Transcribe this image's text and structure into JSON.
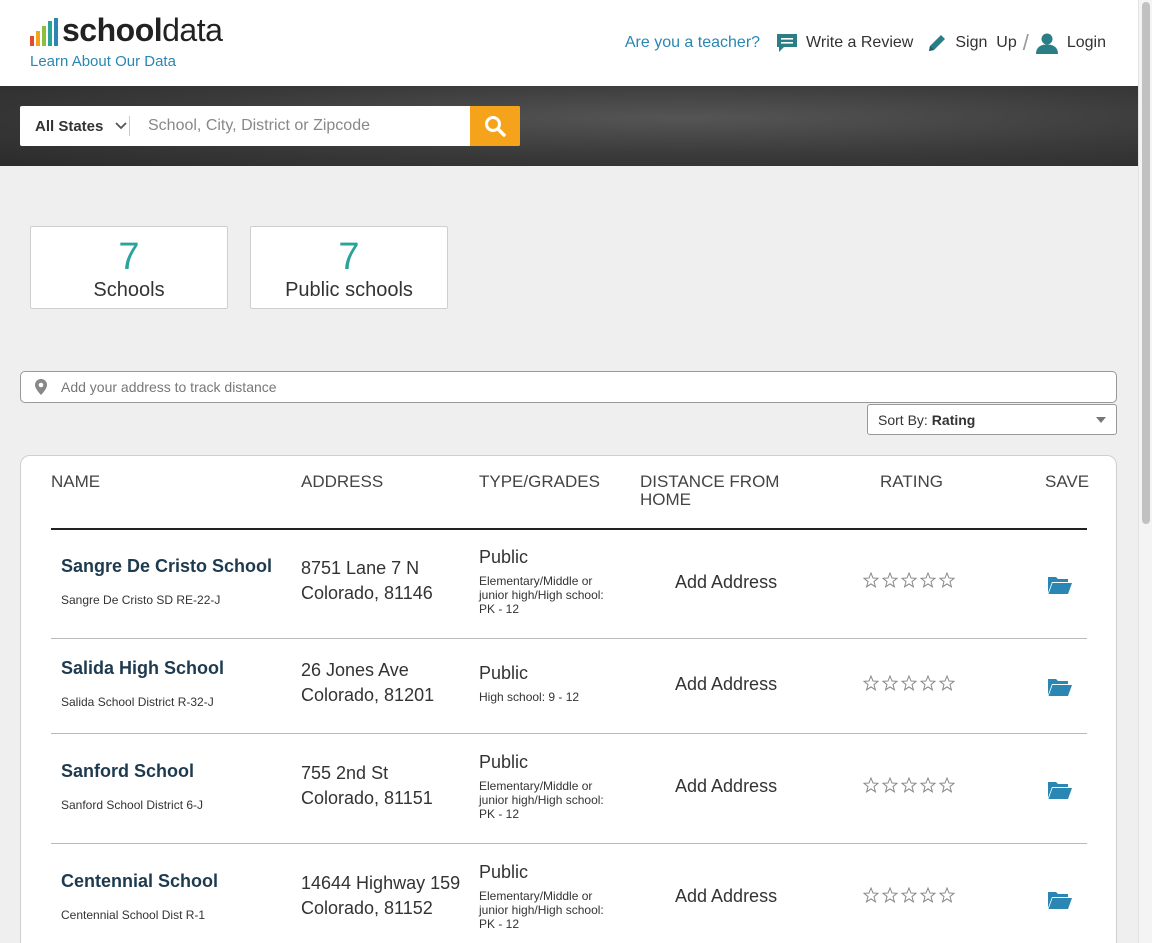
{
  "header": {
    "logo_text_bold": "school",
    "logo_text_light": "data",
    "logo_colors": [
      "#e24a33",
      "#f5a31b",
      "#8cbf3f",
      "#2aa39b",
      "#2a86b3"
    ],
    "learn_link": "Learn About Our Data",
    "teacher_link": "Are you a teacher?",
    "write_review": "Write a Review",
    "sign_up": "Sign  Up",
    "separator": "/",
    "login": "Login"
  },
  "search": {
    "state_selected": "All States",
    "placeholder": "School, City, District or Zipcode",
    "button_color": "#f5a31b"
  },
  "stats": [
    {
      "value": "7",
      "label": "Schools"
    },
    {
      "value": "7",
      "label": "Public schools"
    }
  ],
  "address_bar": {
    "placeholder": "Add your address to track distance"
  },
  "sort": {
    "label": "Sort By:",
    "value": "Rating"
  },
  "table": {
    "headers": {
      "name": "NAME",
      "address": "ADDRESS",
      "type": "TYPE/GRADES",
      "distance_line1": "DISTANCE FROM",
      "distance_line2": "HOME",
      "rating": "RATING",
      "save": "SAVE"
    },
    "rows": [
      {
        "name": "Sangre De Cristo School",
        "district": "Sangre De Cristo SD RE-22-J",
        "street": "8751 Lane 7 N",
        "city": "Colorado, 81146",
        "type": "Public",
        "grades": "Elementary/Middle or junior high/High school: PK - 12",
        "distance": "Add Address",
        "rating": 0
      },
      {
        "name": "Salida High School",
        "district": "Salida School District R-32-J",
        "street": "26 Jones Ave",
        "city": "Colorado, 81201",
        "type": "Public",
        "grades": "High school: 9 - 12",
        "distance": "Add Address",
        "rating": 0
      },
      {
        "name": "Sanford School",
        "district": "Sanford School District 6-J",
        "street": "755 2nd St",
        "city": "Colorado, 81151",
        "type": "Public",
        "grades": "Elementary/Middle or junior high/High school: PK - 12",
        "distance": "Add Address",
        "rating": 0
      },
      {
        "name": "Centennial School",
        "district": "Centennial School Dist R-1",
        "street": "14644 Highway 159",
        "city": "Colorado, 81152",
        "type": "Public",
        "grades": "Elementary/Middle or junior high/High school: PK - 12",
        "distance": "Add Address",
        "rating": 0
      }
    ]
  },
  "icons": {
    "search": "search-icon",
    "review": "chat-bubble-icon",
    "signup": "pencil-icon",
    "login": "user-icon",
    "location": "map-pin-icon",
    "save": "folder-open-icon",
    "rating": "star-outline-icon"
  },
  "colors": {
    "accent_teal": "#2aa39b",
    "link_blue": "#2a86b3",
    "school_name": "#1e3a4f",
    "folder_blue": "#2a86b3"
  }
}
